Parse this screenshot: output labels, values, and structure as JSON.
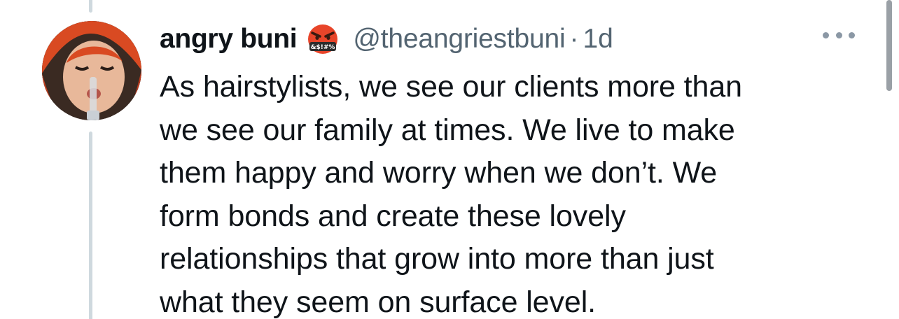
{
  "tweet": {
    "display_name": "angry buni",
    "badge_emoji": "face-with-symbols-on-mouth",
    "badge_text": "&$!#%",
    "handle": "@theangriestbuni",
    "separator": "·",
    "time": "1d",
    "body_lines": [
      "As hairstylists, we see our clients more than",
      "we see our family at times. We live to make",
      "them happy and worry when we don’t. We",
      "form bonds and create these lovely",
      "relationships that grow into more than just",
      "what they seem on surface level."
    ]
  },
  "icons": {
    "more": "more-horizontal-icon"
  },
  "colors": {
    "text_primary": "#0f1419",
    "text_secondary": "#536471",
    "thread_line": "#cfd9de"
  }
}
